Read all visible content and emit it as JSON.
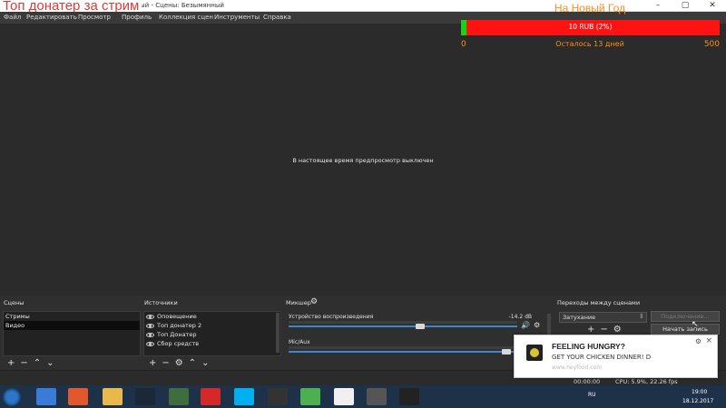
{
  "overlay": {
    "title": "Топ донатер за стрим",
    "goal_title": "На Новый Год",
    "goal_progress_text": "10 RUB (2%)",
    "goal_progress_fraction": 0.02,
    "goal_min": "0",
    "goal_max": "500",
    "goal_days_left": "Осталось 13 дней",
    "goal_color_fill": "#18d418",
    "goal_color_bar": "#ff1212"
  },
  "window": {
    "title_fragment": "нный - Сцены: Безымянный",
    "controls": [
      "minimize-icon",
      "maximize-icon",
      "close-icon"
    ]
  },
  "menu": [
    "Файл",
    "Редактировать",
    "Просмотр",
    "Профиль",
    "Коллекция сцен",
    "Инструменты",
    "Справка"
  ],
  "preview": {
    "message": "В настоящее время предпросмотр выключен"
  },
  "scenes": {
    "title": "Сцены",
    "items": [
      "Стримы",
      "Видео"
    ],
    "selected_index": 1
  },
  "sources": {
    "title": "Источники",
    "items": [
      "Оповещение",
      "Топ донатер 2",
      "Топ Донатер",
      "Сбор средств"
    ]
  },
  "mixer": {
    "title": "Микшер",
    "channels": [
      {
        "name": "Устройство воспроизведения",
        "db": "-14.2 dB",
        "level": 0.58
      },
      {
        "name": "Mic/Aux",
        "db": "",
        "level": 0.97
      }
    ]
  },
  "transitions": {
    "title": "Переходы между сценами",
    "selected": "Затухание"
  },
  "controls": {
    "buttons": [
      "Подключение...",
      "Начать запись"
    ]
  },
  "status": {
    "timer": "00:00:00",
    "cpu": "CPU: 5.9%, 22.26 fps"
  },
  "toast": {
    "title": "FEELING HUNGRY?",
    "body": "GET YOUR CHICKEN DINNER! D",
    "link": "www.heyfood.com"
  },
  "taskbar": {
    "language": "RU",
    "time": "19:00",
    "date": "18.12.2017",
    "apps": [
      "ie-icon",
      "media-player-icon",
      "explorer-icon",
      "steam-icon",
      "app-icon",
      "yandex-icon",
      "skype-icon",
      "nox-icon",
      "chrome-icon",
      "yandex-browser-icon",
      "settings-icon",
      "obs-icon"
    ]
  }
}
